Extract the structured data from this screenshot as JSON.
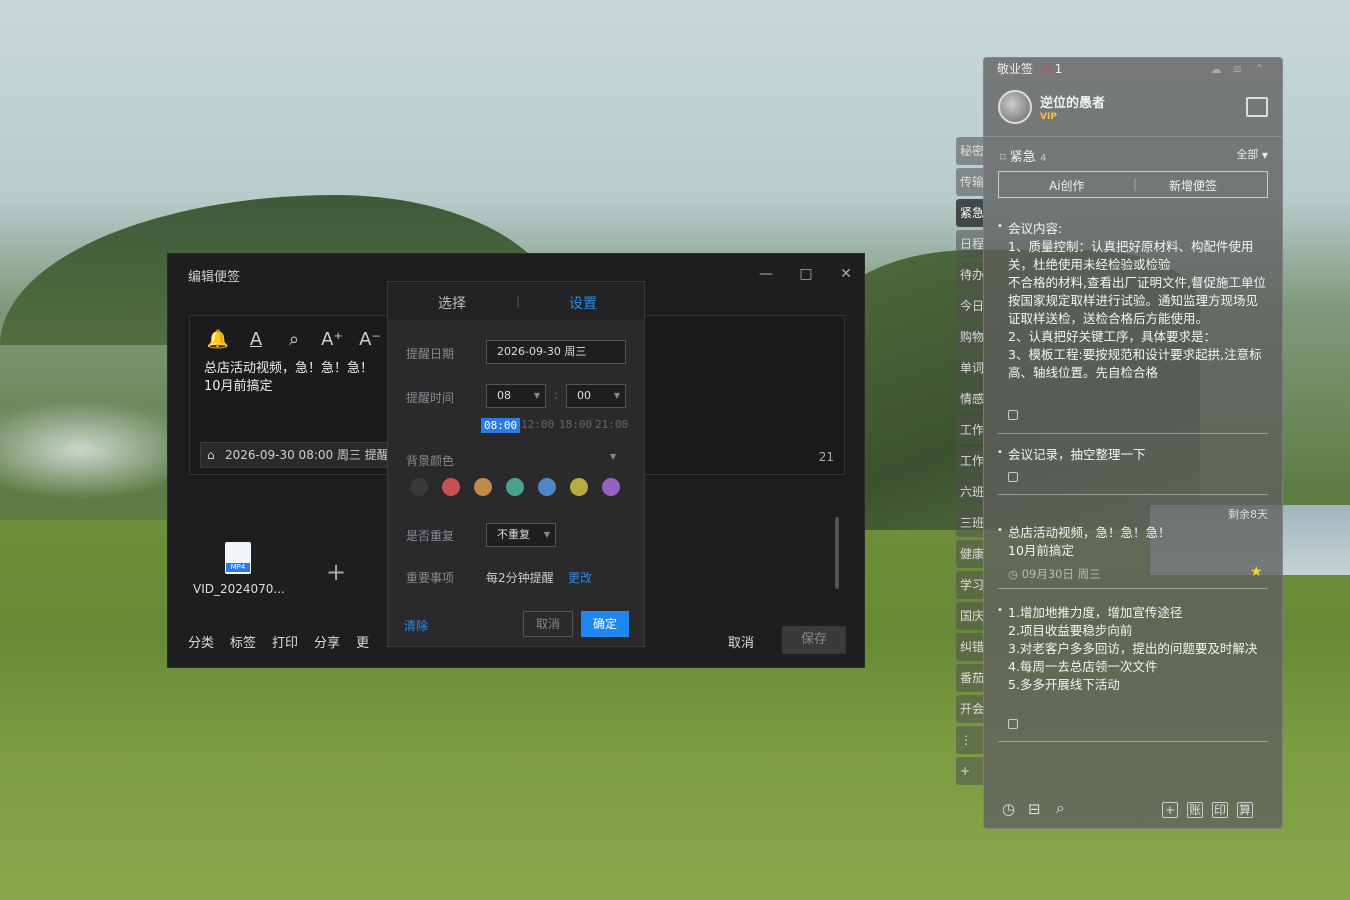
{
  "edit_window": {
    "title": "编辑便签",
    "controls": [
      "—",
      "□",
      "✕"
    ],
    "toolbar": [
      "bell-icon",
      "text-color-icon",
      "search-icon",
      "font-increase-icon",
      "font-decrease-icon"
    ],
    "toolbar_glyphs": [
      "🔔",
      "A",
      "⌕",
      "A⁺",
      "A⁻"
    ],
    "note_text": "总店活动视频，急！急！急！\n10月前搞定",
    "reminder_chip": "2026-09-30 08:00 周三 提醒",
    "char_count": "21",
    "attachment": {
      "name": "VID_2024070...",
      "badge": "MP4"
    },
    "bottom_actions": [
      "分类",
      "标签",
      "打印",
      "分享",
      "更"
    ],
    "cancel_label": "取消",
    "save_label": "保存"
  },
  "reminder_dialog": {
    "tabs": [
      "选择",
      "设置"
    ],
    "active_tab": "设置",
    "date_label": "提醒日期",
    "date_value": "2026-09-30  周三",
    "time_label": "提醒时间",
    "hour": "08",
    "minute": "00",
    "quick_times": [
      "08:00",
      "12:00",
      "18:00",
      "21:00"
    ],
    "bg_color_label": "背景颜色",
    "bg_colors": [
      "#3a3a3d",
      "#c94f55",
      "#c0894d",
      "#4aa28a",
      "#4f86c6",
      "#b5ad3f",
      "#9561c2"
    ],
    "repeat_label": "是否重复",
    "repeat_value": "不重复",
    "important_label": "重要事项",
    "important_value": "每2分钟提醒",
    "important_change": "更改",
    "clear_label": "清除",
    "cancel_label": "取消",
    "ok_label": "确定"
  },
  "side_tabs": [
    "秘密",
    "传输",
    "紧急",
    "日程",
    "待办",
    "今日",
    "购物",
    "单词",
    "情感",
    "工作",
    "工作",
    "六班",
    "三班",
    "健康",
    "学习",
    "国庆",
    "纠错",
    "番茄",
    "开会",
    "⋮",
    "+"
  ],
  "panel": {
    "app_name": "敬业签",
    "bell_count": "1",
    "user_name": "逆位的愚者",
    "vip_label": "VIP",
    "category": "紧急",
    "category_count": "4",
    "filter": "全部",
    "ai_button": "Ai创作",
    "new_button": "新增便签",
    "notes": [
      {
        "text": "会议内容:\n1、质量控制：认真把好原材料、构配件使用关，杜绝使用未经检验或检验\n不合格的材料,查看出厂证明文件,督促施工单位按国家规定取样进行试验。通知监理方现场见证取样送检，送检合格后方能使用。\n2、认真把好关键工序，具体要求是：\n3、模板工程:要按规范和设计要求起拱,注意标高、轴线位置。先自检合格"
      },
      {
        "text": "会议记录，抽空整理一下"
      },
      {
        "text": "总店活动视频，急！急！急！\n10月前搞定",
        "remaining": "剩余8天",
        "date": "09月30日 周三"
      },
      {
        "text": "1.增加地推力度，增加宣传途径\n2.项目收益要稳步向前\n3.对老客户多多回访，提出的问题要及时解决\n4.每周一去总店领一次文件\n5.多多开展线下活动"
      }
    ],
    "footer_icons": [
      "clock-icon",
      "archive-icon",
      "search-icon",
      "add-icon",
      "ledger-icon",
      "print-icon",
      "calculator-icon"
    ],
    "footer_glyphs": [
      "+",
      "账",
      "印",
      "算"
    ]
  }
}
